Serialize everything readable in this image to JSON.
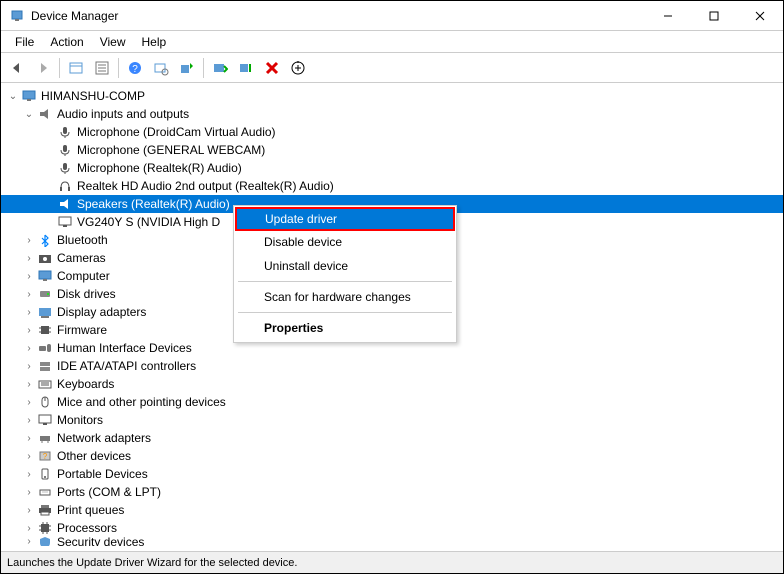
{
  "window": {
    "title": "Device Manager"
  },
  "menu": {
    "file": "File",
    "action": "Action",
    "view": "View",
    "help": "Help"
  },
  "tree": {
    "root": "HIMANSHU-COMP",
    "audio_category": "Audio inputs and outputs",
    "audio_items": {
      "mic_droidcam": "Microphone (DroidCam Virtual Audio)",
      "mic_webcam": "Microphone (GENERAL WEBCAM)",
      "mic_realtek": "Microphone (Realtek(R) Audio)",
      "realtek_2nd": "Realtek HD Audio 2nd output (Realtek(R) Audio)",
      "speakers": "Speakers (Realtek(R) Audio)",
      "vg240y": "VG240Y S (NVIDIA High D"
    },
    "categories": {
      "bluetooth": "Bluetooth",
      "cameras": "Cameras",
      "computer": "Computer",
      "disk_drives": "Disk drives",
      "display_adapters": "Display adapters",
      "firmware": "Firmware",
      "hid": "Human Interface Devices",
      "ide": "IDE ATA/ATAPI controllers",
      "keyboards": "Keyboards",
      "mice": "Mice and other pointing devices",
      "monitors": "Monitors",
      "network": "Network adapters",
      "other": "Other devices",
      "portable": "Portable Devices",
      "ports": "Ports (COM & LPT)",
      "print_queues": "Print queues",
      "processors": "Processors",
      "security": "Security devices"
    }
  },
  "context_menu": {
    "update_driver": "Update driver",
    "disable_device": "Disable device",
    "uninstall_device": "Uninstall device",
    "scan": "Scan for hardware changes",
    "properties": "Properties"
  },
  "statusbar": {
    "text": "Launches the Update Driver Wizard for the selected device."
  }
}
